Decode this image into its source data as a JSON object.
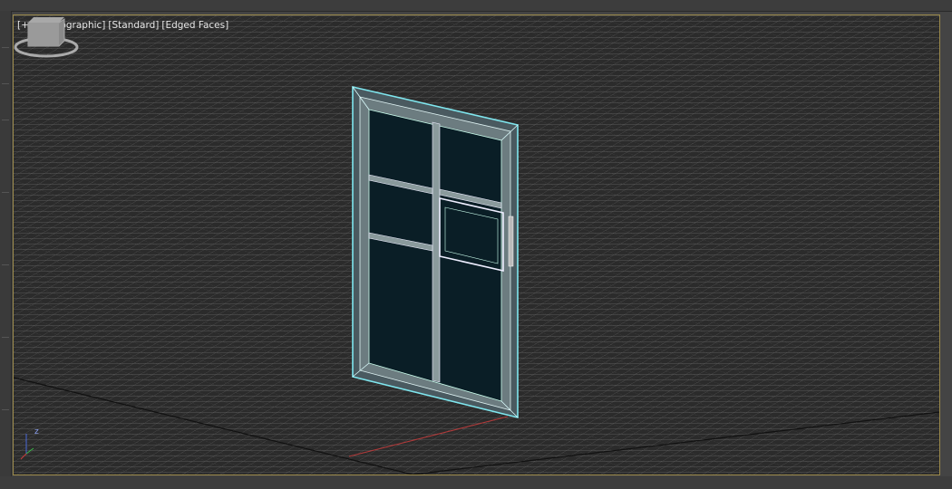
{
  "viewport": {
    "menu_plus": "[+]",
    "view_mode": "[Orthographic]",
    "shading_mode": "[Standard]",
    "display_mode": "[Edged Faces]"
  },
  "colors": {
    "frame_border": "#9c8a4a",
    "selection": "#7fe6ee",
    "glass": "#0a1e26",
    "grid": "#6a6a6a"
  },
  "axis": {
    "z": "z",
    "x": "x",
    "y": "y"
  }
}
